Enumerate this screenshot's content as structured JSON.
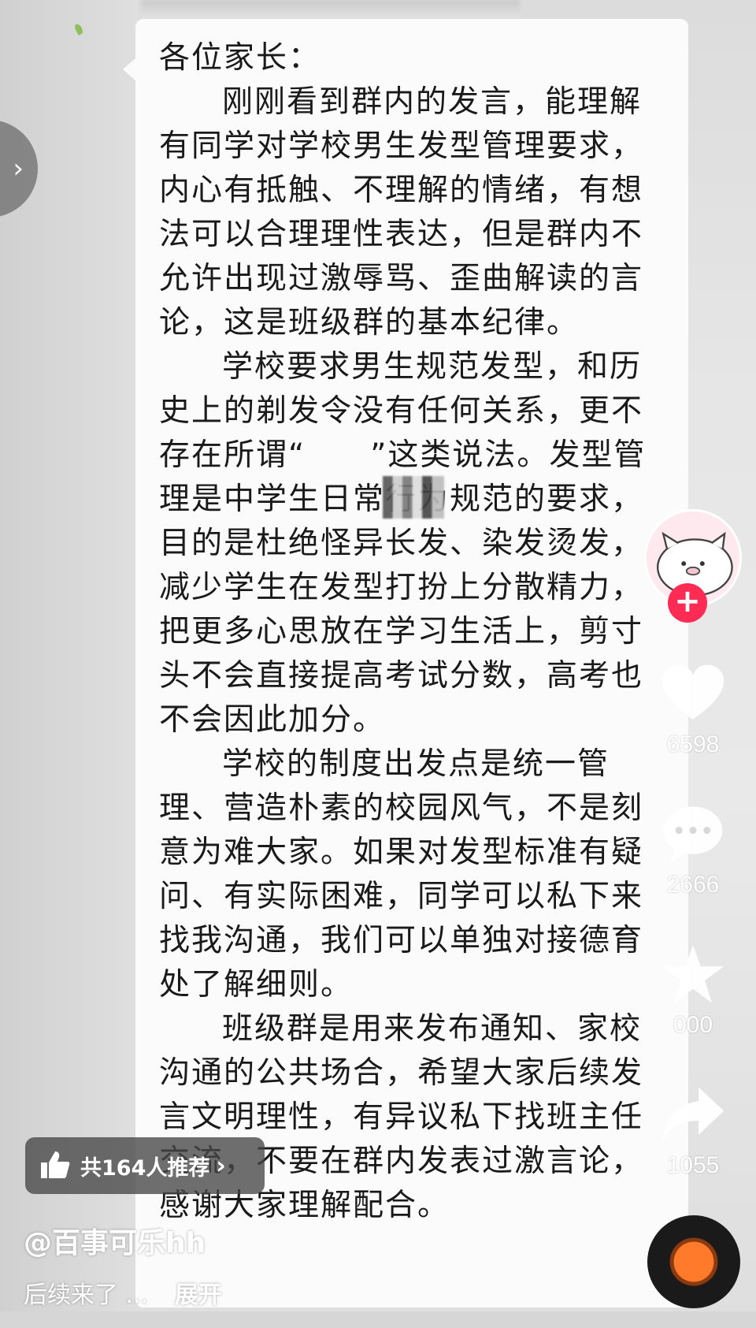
{
  "message": {
    "greeting": "各位家长：",
    "paragraphs": [
      "刚刚看到群内的发言，能理解有同学对学校男生发型管理要求，内心有抵触、不理解的情绪，有想法可以合理理性表达，但是群内不允许出现过激辱骂、歪曲解读的言论，这是班级群的基本纪律。",
      "学校要求男生规范发型，和历史上的剃发令没有任何关系，更不存在所谓“　　”这类说法。发型管理是中学生日常行为规范的要求，目的是杜绝怪异长发、染发烫发，减少学生在发型打扮上分散精力，把更多心思放在学习生活上，剪寸头不会直接提高考试分数，高考也不会因此加分。",
      "学校的制度出发点是统一管理、营造朴素的校园风气，不是刻意为难大家。如果对发型标准有疑问、有实际困难，同学可以私下来找我沟通，我们可以单独对接德育处了解细则。",
      "班级群是用来发布通知、家校沟通的公共场合，希望大家后续发言文明理性，有异议私下找班主任交流，不要在群内发表过激言论，感谢大家理解配合。"
    ]
  },
  "actions": {
    "likes": "6598",
    "comments": "2666",
    "favorites": "000",
    "shares": "1055"
  },
  "recommend": {
    "label": "共164人推荐",
    "chevron": "›"
  },
  "author": "@百事可乐hh",
  "caption": {
    "text": "后续来了 ...",
    "more": "展开"
  },
  "colors": {
    "follow": "#fe2c55",
    "panel": "#fbfbfb"
  }
}
